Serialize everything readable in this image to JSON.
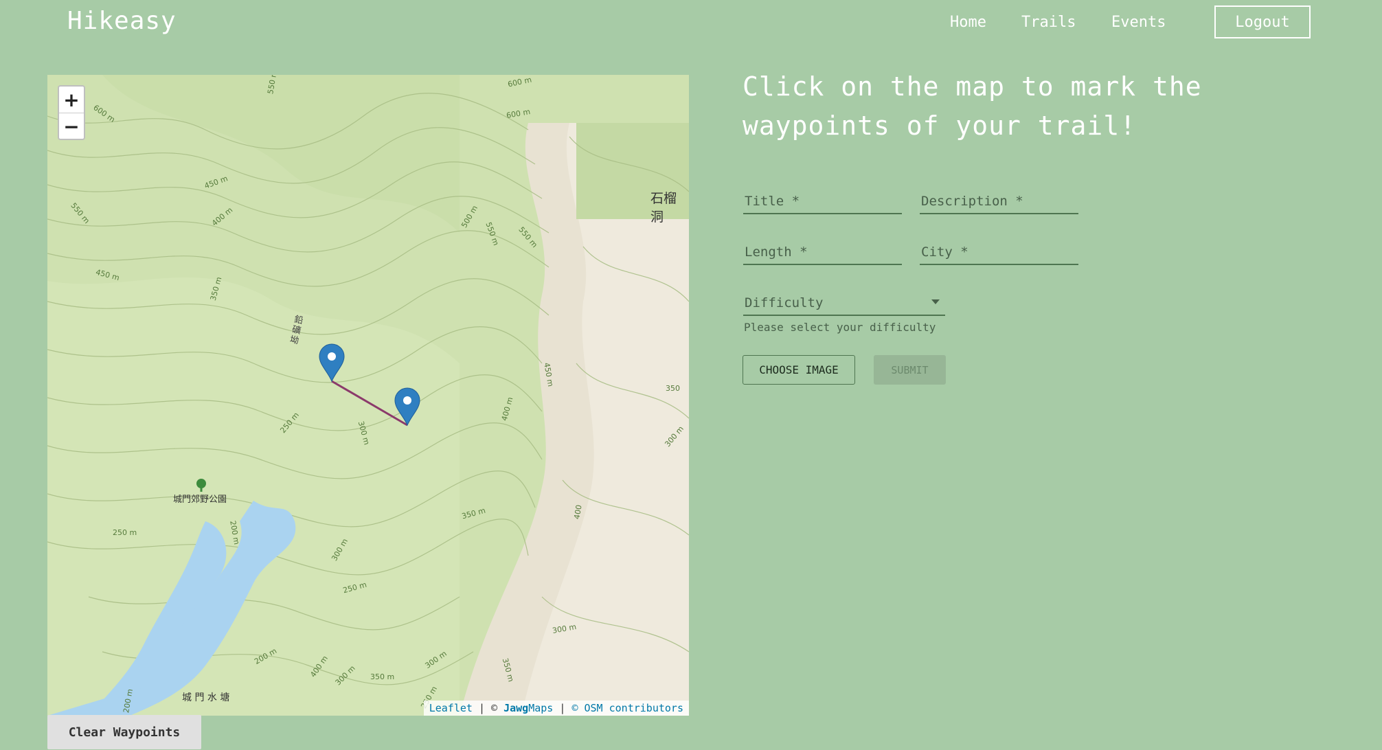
{
  "header": {
    "brand": "Hikeasy",
    "nav": {
      "home": "Home",
      "trails": "Trails",
      "events": "Events"
    },
    "logout": "Logout"
  },
  "map": {
    "zoom_in": "+",
    "zoom_out": "−",
    "labels": {
      "place_top_right": "石榴洞",
      "park": "城門郊野公園",
      "reservoir": "城 門 水 塘",
      "trail_name": "鉛礦坳"
    },
    "contours": [
      "550 m",
      "500",
      "550 m",
      "600 m",
      "600 m",
      "450 m",
      "400 m",
      "550 m",
      "450 m",
      "350 m",
      "450 m",
      "500 m",
      "550 m",
      "450 m",
      "400 m",
      "250 m",
      "300 m",
      "350",
      "300 m",
      "250 m",
      "200 m",
      "300 m",
      "350 m",
      "400 m",
      "400",
      "250 m",
      "200 m",
      "200",
      "350 m",
      "300 m",
      "400 m",
      "350 m",
      "300 m",
      "200 m",
      "250 m"
    ],
    "attribution": {
      "leaflet": "Leaflet",
      "sep1": "|",
      "copy1": "©",
      "jawg": "Jawg",
      "maps": "Maps",
      "sep2": "|",
      "osm": "© OSM contributors"
    }
  },
  "clear_button": "Clear Waypoints",
  "form": {
    "headline": "Click on the map to mark the waypoints of your trail!",
    "title_label": "Title *",
    "description_label": "Description *",
    "length_label": "Length *",
    "city_label": "City *",
    "difficulty_label": "Difficulty",
    "difficulty_helper": "Please select your difficulty",
    "choose_image": "CHOOSE IMAGE",
    "submit": "SUBMIT"
  },
  "colors": {
    "background": "#a7cba6",
    "route": "#8b3a6b",
    "marker": "#2f7fc1",
    "water": "#aad3f0"
  }
}
